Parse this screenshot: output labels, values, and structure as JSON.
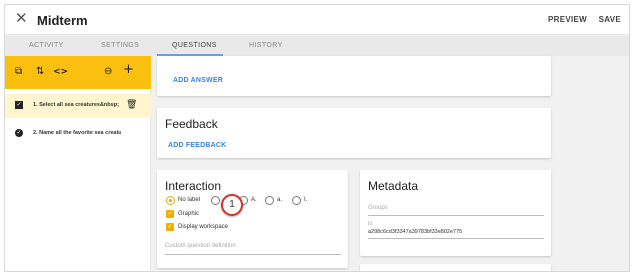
{
  "header": {
    "close_glyph": "✕",
    "title": "Midterm",
    "preview_label": "PREVIEW",
    "save_label": "SAVE"
  },
  "tabs": [
    {
      "label": "ACTIVITY",
      "active": false
    },
    {
      "label": "SETTINGS",
      "active": false
    },
    {
      "label": "QUESTIONS",
      "active": true
    },
    {
      "label": "HISTORY",
      "active": false
    }
  ],
  "sidebar": {
    "toolbar_icons": [
      "preview-icon",
      "reorder-icon",
      "code-icon",
      "link-icon",
      "add-icon"
    ],
    "toolbar_glyphs": {
      "preview": "⧉",
      "reorder": "⇅",
      "code": "<>",
      "link": "⊖",
      "add": "+"
    },
    "questions": [
      {
        "label": "1. Select all sea creatures&nbsp;",
        "selected": true
      },
      {
        "label": "2. Name all the favorite sea creatures",
        "selected": false
      }
    ],
    "trash_glyph": "🗑"
  },
  "answers": {
    "add_answer_label": "ADD ANSWER"
  },
  "feedback": {
    "title": "Feedback",
    "add_feedback_label": "ADD FEEDBACK"
  },
  "interaction": {
    "title": "Interaction",
    "label_options": [
      {
        "label": "No label",
        "selected": true
      },
      {
        "label": "",
        "selected": false
      },
      {
        "label": "A.",
        "selected": false
      },
      {
        "label": "a.",
        "selected": false
      },
      {
        "label": "I.",
        "selected": false
      }
    ],
    "checkboxes": [
      {
        "label": "Graphic",
        "checked": true
      },
      {
        "label": "Display workspace",
        "checked": true
      }
    ],
    "custom_placeholder": "Custom question definition"
  },
  "metadata": {
    "title": "Metadata",
    "groups_placeholder": "Groups",
    "id_label": "id",
    "id_value": "a298c6cd3f3347a39783bf33e802e775"
  },
  "step_badge": "1",
  "colors": {
    "accent": "#fbbf10",
    "link": "#3a84d8",
    "selected_row": "#fff6d0",
    "badge_border": "#d2342c"
  }
}
